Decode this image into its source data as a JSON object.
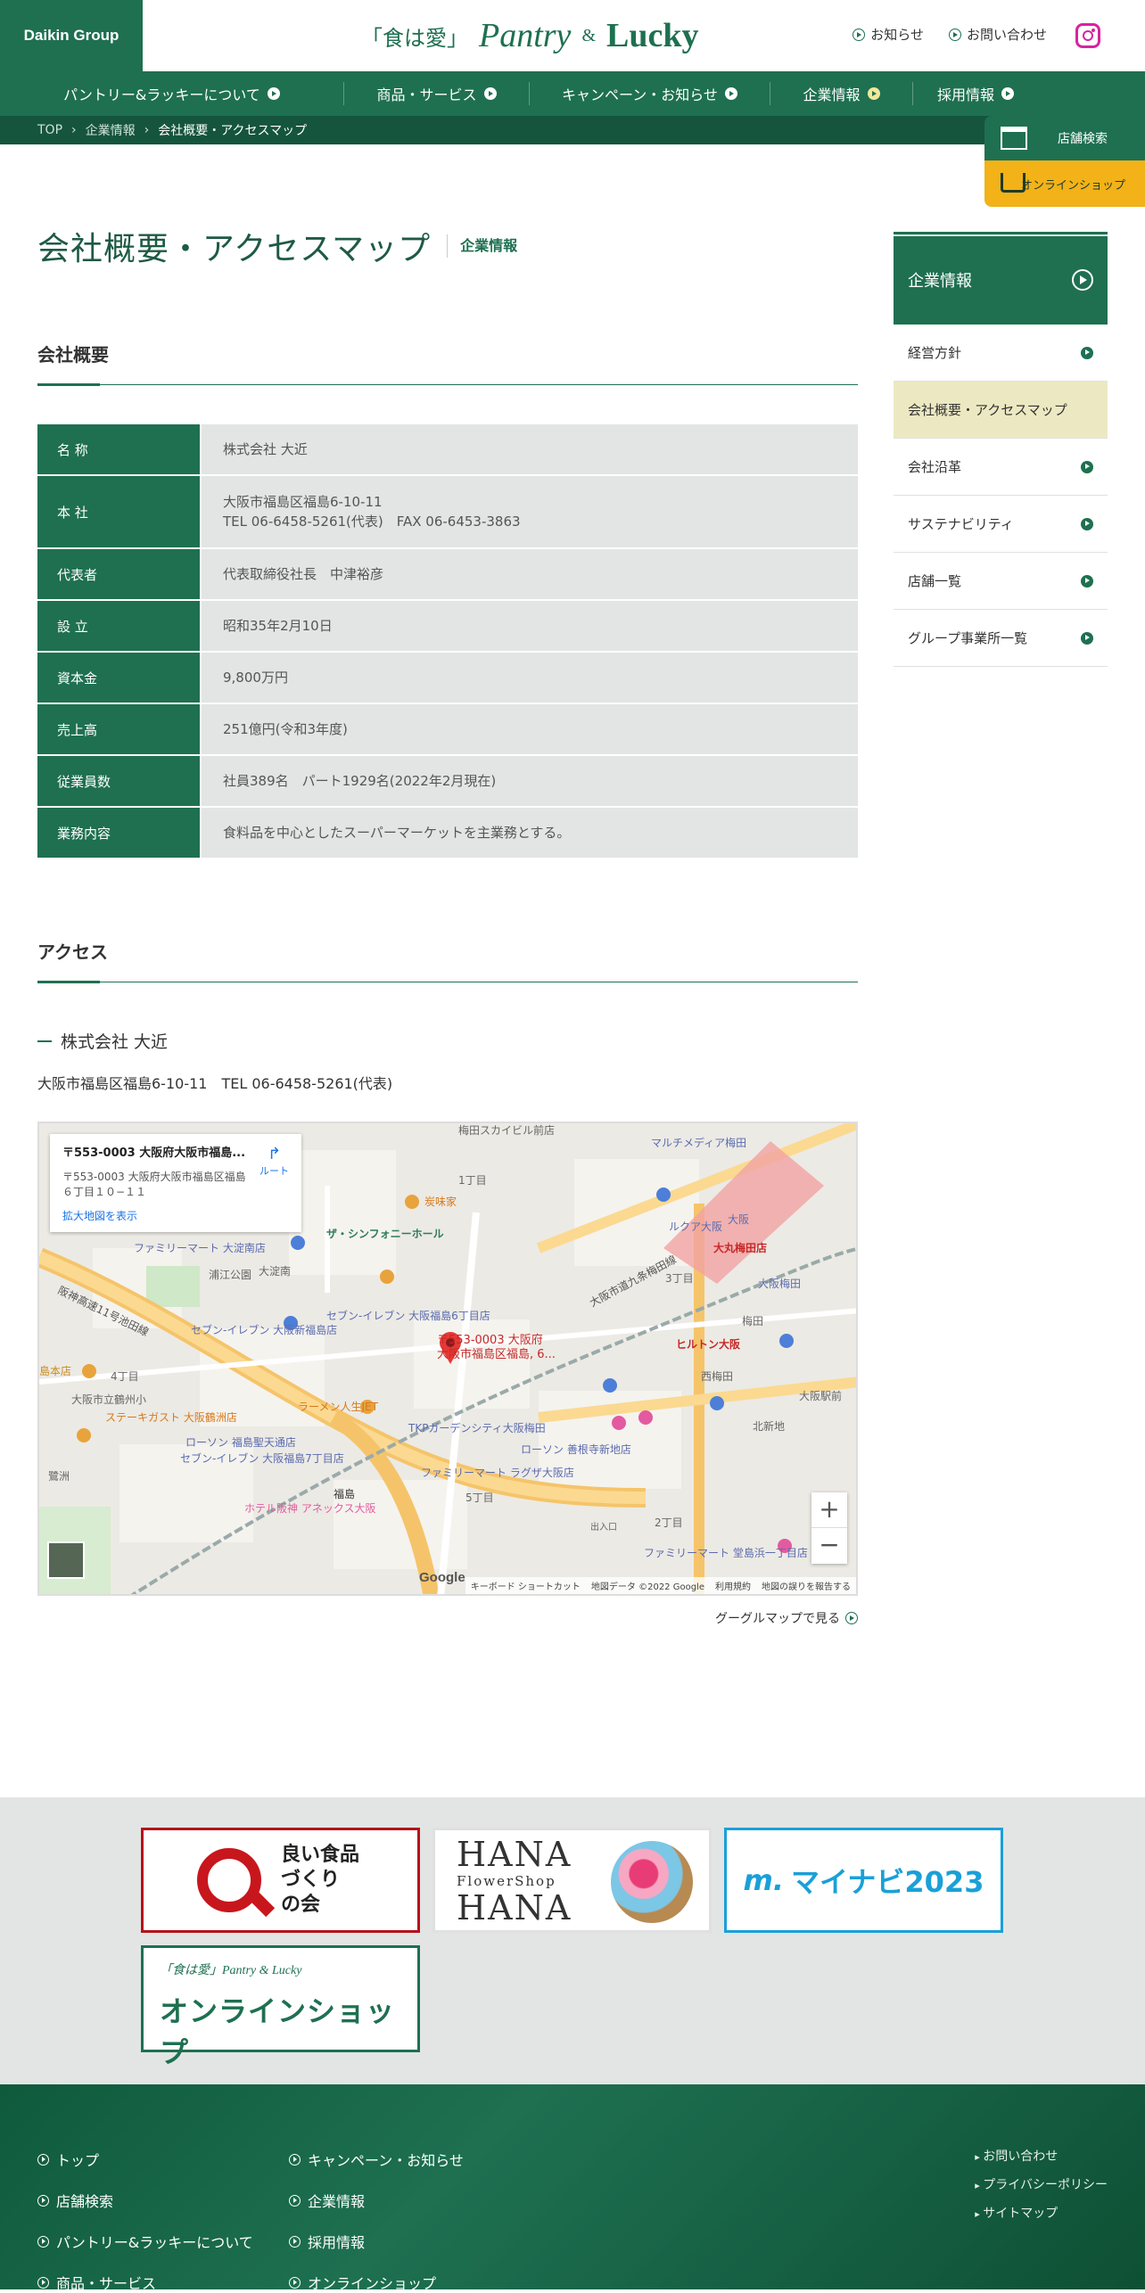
{
  "header": {
    "group_logo": "Daikin Group",
    "brand": {
      "slogan": "「食は愛」",
      "pantry": "Pantry",
      "amp": "&",
      "lucky": "Lucky"
    },
    "links": [
      {
        "label": "お知らせ"
      },
      {
        "label": "お問い合わせ"
      }
    ],
    "instagram_icon": "instagram-icon"
  },
  "gnav": [
    {
      "label": "パントリー&ラッキーについて"
    },
    {
      "label": "商品・サービス"
    },
    {
      "label": "キャンペーン・お知らせ"
    },
    {
      "label": "企業情報"
    },
    {
      "label": "採用情報"
    }
  ],
  "breadcrumb": {
    "items": [
      "TOP",
      "企業情報"
    ],
    "current": "会社概要・アクセスマップ",
    "separator": "›"
  },
  "floating": {
    "store_search": "店舗検索",
    "online_shop": "オンラインショップ"
  },
  "page": {
    "title": "会社概要・アクセスマップ",
    "category": "企業情報"
  },
  "overview": {
    "heading": "会社概要",
    "rows": [
      {
        "label": "名 称",
        "value": "株式会社 大近"
      },
      {
        "label": "本 社",
        "value": "大阪市福島区福島6-10-11",
        "value2": "TEL 06-6458-5261(代表)　FAX 06-6453-3863"
      },
      {
        "label": "代表者",
        "value": "代表取締役社長　中津裕彦"
      },
      {
        "label": "設 立",
        "value": "昭和35年2月10日"
      },
      {
        "label": "資本金",
        "value": "9,800万円"
      },
      {
        "label": "売上高",
        "value": "251億円(令和3年度)"
      },
      {
        "label": "従業員数",
        "value": "社員389名　パート1929名(2022年2月現在)"
      },
      {
        "label": "業務内容",
        "value": "食料品を中心としたスーパーマーケットを主業務とする。"
      }
    ]
  },
  "access": {
    "heading": "アクセス",
    "company": "株式会社 大近",
    "address": "大阪市福島区福島6-10-11　TEL 06-6458-5261(代表)",
    "map": {
      "card_title": "〒553-0003 大阪府大阪市福島...",
      "card_addr1": "〒553-0003 大阪府大阪市福島区福島",
      "card_addr2": "６丁目１０−１１",
      "card_link": "拡大地図を表示",
      "route": "ルート",
      "pin_label1": "〒553-0003 大阪府",
      "pin_label2": "大阪市福島区福島, 6...",
      "labels": [
        "梅田スカイビル前店",
        "マルチメディア梅田",
        "ルクア大阪",
        "大阪",
        "大丸梅田店",
        "大阪梅田",
        "ヒルトン大阪",
        "西梅田",
        "梅田",
        "大阪駅前",
        "ザ・シンフォニーホール",
        "ファミリーマート 大淀南店",
        "大淀南",
        "浦江公園",
        "セブン-イレブン 大阪福島6丁目店",
        "セブン-イレブン 大阪新福島店",
        "阪神高速11号池田線",
        "4丁目",
        "島本店",
        "大阪市立鶴州小",
        "ステーキガスト 大阪鶴洲店",
        "ローソン 福島聖天通店",
        "セブン-イレブン 大阪福島7丁目店",
        "ホテル阪神 アネックス大阪",
        "福島",
        "鷺洲",
        "TKPガーデンシティ大阪梅田",
        "ファミリーマート ラグザ大阪店",
        "ローソン 善根寺新地店",
        "5丁目",
        "2丁目",
        "ファミリーマート 堂島浜一丁目店",
        "大阪市道九条梅田線",
        "3丁目",
        "1丁目",
        "炭味家",
        "北新地",
        "出入口",
        "ラーメン人生JET"
      ],
      "zoom_in": "+",
      "zoom_out": "−",
      "google": "Google",
      "foot": [
        "キーボード ショートカット",
        "地図データ ©2022 Google",
        "利用規約",
        "地図の誤りを報告する"
      ]
    },
    "map_link": "グーグルマップで見る"
  },
  "side_nav": {
    "head": "企業情報",
    "items": [
      {
        "label": "経営方針"
      },
      {
        "label": "会社概要・アクセスマップ",
        "active": true
      },
      {
        "label": "会社沿革"
      },
      {
        "label": "サステナビリティ"
      },
      {
        "label": "店舗一覧"
      },
      {
        "label": "グループ事業所一覧"
      }
    ]
  },
  "banners": {
    "yoi": [
      "良い食品",
      "づくり",
      "の会"
    ],
    "hana": {
      "top": "HANA",
      "mid": "FlowerShop",
      "bottom": "HANA"
    },
    "mynavi": {
      "mark": "m.",
      "text": "マイナビ2023"
    },
    "online": {
      "small": "「食は愛」Pantry & Lucky",
      "big": "オンラインショップ"
    }
  },
  "footer": {
    "col1": [
      "トップ",
      "店舗検索",
      "パントリー&ラッキーについて",
      "商品・サービス"
    ],
    "col2": [
      "キャンペーン・お知らせ",
      "企業情報",
      "採用情報",
      "オンラインショップ"
    ],
    "sub": [
      "お問い合わせ",
      "プライバシーポリシー",
      "サイトマップ"
    ]
  },
  "colors": {
    "brand_green": "#1e7051",
    "accent_yellow": "#f2b218",
    "active_bg": "#ece9c2"
  }
}
